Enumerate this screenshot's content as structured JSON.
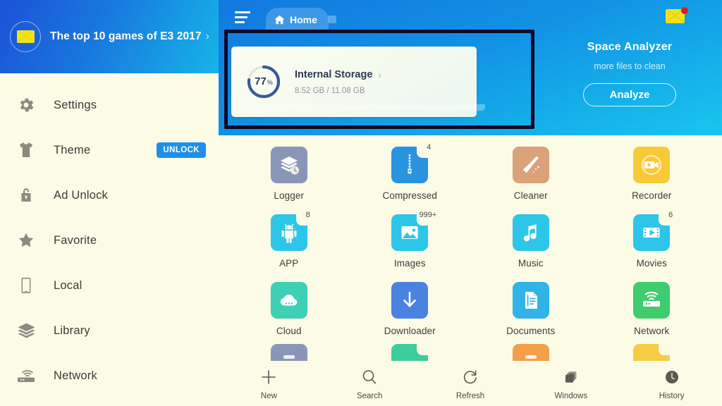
{
  "sidebar": {
    "banner": {
      "icon": "envelope-icon",
      "text": "The top 10 games of E3 2017",
      "chevron": "›"
    },
    "items": [
      {
        "label": "Settings",
        "icon": "gear-icon"
      },
      {
        "label": "Theme",
        "icon": "tshirt-icon",
        "badge": "UNLOCK"
      },
      {
        "label": "Ad Unlock",
        "icon": "lock-open-icon"
      },
      {
        "label": "Favorite",
        "icon": "star-icon"
      },
      {
        "label": "Local",
        "icon": "phone-icon"
      },
      {
        "label": "Library",
        "icon": "layers-icon"
      },
      {
        "label": "Network",
        "icon": "router-icon"
      }
    ]
  },
  "header": {
    "menu_icon": "hamburger-icon",
    "tab_label": "Home",
    "tab_icon": "home-icon",
    "mail_icon": "envelope-icon",
    "storage": {
      "percent": "77",
      "percent_symbol": "%",
      "percent_value": 77,
      "title": "Internal Storage",
      "chevron": "›",
      "usage": "8.52 GB / 11.08 GB",
      "used_gb": 8.52,
      "total_gb": 11.08
    },
    "analyzer": {
      "title": "Space Analyzer",
      "subtitle": "more files to clean",
      "button": "Analyze"
    }
  },
  "apps": [
    {
      "label": "Logger",
      "icon": "layers-clock-icon",
      "color": "#8A96B8",
      "badge": ""
    },
    {
      "label": "Compressed",
      "icon": "zip-icon",
      "color": "#2A93E0",
      "badge": "4"
    },
    {
      "label": "Cleaner",
      "icon": "broom-icon",
      "color": "#D9A278",
      "badge": ""
    },
    {
      "label": "Recorder",
      "icon": "camcorder-icon",
      "color": "#F7C937",
      "badge": ""
    },
    {
      "label": "APP",
      "icon": "android-icon",
      "color": "#2DC6E8",
      "badge": "8"
    },
    {
      "label": "Images",
      "icon": "picture-icon",
      "color": "#2DC6E8",
      "badge": "999+"
    },
    {
      "label": "Music",
      "icon": "music-note-icon",
      "color": "#2DC6E8",
      "badge": ""
    },
    {
      "label": "Movies",
      "icon": "film-play-icon",
      "color": "#2DC6E8",
      "badge": "6"
    },
    {
      "label": "Cloud",
      "icon": "cloud-icon",
      "color": "#3ED0B4",
      "badge": ""
    },
    {
      "label": "Downloader",
      "icon": "download-icon",
      "color": "#4A82E0",
      "badge": ""
    },
    {
      "label": "Documents",
      "icon": "document-icon",
      "color": "#2FB3E8",
      "badge": ""
    },
    {
      "label": "Network",
      "icon": "router-icon",
      "color": "#3ECC6E",
      "badge": ""
    }
  ],
  "partial_row_colors": [
    "#8A96B8",
    "#3ECC9A",
    "#F2A04A",
    "#F5CC44"
  ],
  "toolbar": [
    {
      "label": "New",
      "icon": "plus-icon"
    },
    {
      "label": "Search",
      "icon": "search-icon"
    },
    {
      "label": "Refresh",
      "icon": "refresh-icon"
    },
    {
      "label": "Windows",
      "icon": "windows-stack-icon"
    },
    {
      "label": "History",
      "icon": "clock-icon"
    }
  ],
  "colors": {
    "sidebar_bg": "#FBFBE6",
    "header_blue": "#1190E4",
    "accent_cyan": "#18C6EE",
    "unlock_badge": "#1E90E8",
    "highlight_rect": "#0A0A28",
    "badge_red": "#E21B1B"
  }
}
